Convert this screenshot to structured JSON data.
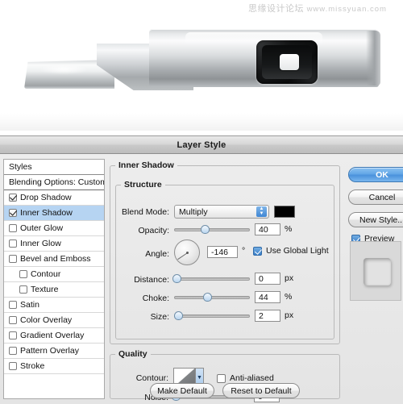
{
  "watermark": {
    "cn": "思缘设计论坛",
    "url": "www.missyuan.com"
  },
  "canvas": {
    "object_name": "metallic-tool-render"
  },
  "dialog": {
    "title": "Layer Style",
    "styles_panel": {
      "header": "Styles",
      "blending_options": "Blending Options: Custom",
      "items": [
        {
          "label": "Drop Shadow",
          "checked": true,
          "indent": false
        },
        {
          "label": "Inner Shadow",
          "checked": true,
          "indent": false,
          "selected": true
        },
        {
          "label": "Outer Glow",
          "checked": false,
          "indent": false
        },
        {
          "label": "Inner Glow",
          "checked": false,
          "indent": false
        },
        {
          "label": "Bevel and Emboss",
          "checked": false,
          "indent": false
        },
        {
          "label": "Contour",
          "checked": false,
          "indent": true
        },
        {
          "label": "Texture",
          "checked": false,
          "indent": true
        },
        {
          "label": "Satin",
          "checked": false,
          "indent": false
        },
        {
          "label": "Color Overlay",
          "checked": false,
          "indent": false
        },
        {
          "label": "Gradient Overlay",
          "checked": false,
          "indent": false
        },
        {
          "label": "Pattern Overlay",
          "checked": false,
          "indent": false
        },
        {
          "label": "Stroke",
          "checked": false,
          "indent": false
        }
      ]
    },
    "effect": {
      "group_title": "Inner Shadow",
      "structure": {
        "legend": "Structure",
        "blend_mode_label": "Blend Mode:",
        "blend_mode_value": "Multiply",
        "color_swatch": "#000000",
        "opacity_label": "Opacity:",
        "opacity_value": "40",
        "opacity_unit": "%",
        "angle_label": "Angle:",
        "angle_value": "-146",
        "angle_unit": "°",
        "use_global_light": "Use Global Light",
        "use_global_light_checked": true,
        "distance_label": "Distance:",
        "distance_value": "0",
        "distance_unit": "px",
        "choke_label": "Choke:",
        "choke_value": "44",
        "choke_unit": "%",
        "size_label": "Size:",
        "size_value": "2",
        "size_unit": "px"
      },
      "quality": {
        "legend": "Quality",
        "contour_label": "Contour:",
        "anti_aliased": "Anti-aliased",
        "anti_aliased_checked": false,
        "noise_label": "Noise:",
        "noise_value": "0",
        "noise_unit": "%"
      },
      "make_default": "Make Default",
      "reset_to_default": "Reset to Default"
    },
    "actions": {
      "ok": "OK",
      "cancel": "Cancel",
      "new_style": "New Style...",
      "preview": "Preview",
      "preview_checked": true
    },
    "colors": {
      "selection": "#b6d4f2",
      "accent": "#4a92dc",
      "dialog_bg": "#e8e8e8",
      "swatch": "#000000"
    },
    "slider_positions": {
      "opacity_pct": 40,
      "distance_pct": 2,
      "choke_pct": 44,
      "size_pct": 4,
      "noise_pct": 2
    }
  }
}
